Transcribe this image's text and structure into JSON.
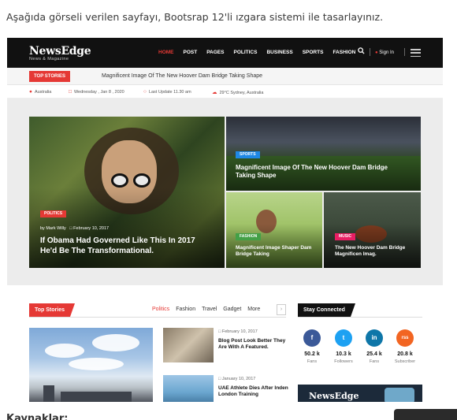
{
  "instruction": "Aşağıda görseli verilen sayfayı, Bootsrap 12'li ızgara sistemi ile tasarlayınız.",
  "site": {
    "logo": "NewsEdge",
    "logo_sub": "News & Magazine",
    "nav": [
      "HOME",
      "POST",
      "PAGES",
      "POLITICS",
      "BUSINESS",
      "SPORTS",
      "FASHION"
    ],
    "sign_in": "Sign In"
  },
  "ticker": {
    "badge": "TOP STORIES",
    "headline": "Magnificent Image Of The New Hoover Dam Bridge Taking Shape"
  },
  "infobar": {
    "location": "Australia",
    "date": "Wednesday , Jan 8 , 2020",
    "last_update": "Last Update 11.30 am",
    "weather": "29°C Sydney, Australia"
  },
  "hero": {
    "main": {
      "category": "POLITICS",
      "author_prefix": "by",
      "author": "Mark Willy",
      "date": "February 10, 2017",
      "title": "If Obama Had Governed Like This In 2017 He'd Be The Transformational."
    },
    "top": {
      "category": "SPORTS",
      "title": "Magnificent Image Of The New Hoover Dam Bridge Taking Shape"
    },
    "bottom_left": {
      "category": "FASHION",
      "title": "Magnificent Image Shaper Dam Bridge Taking"
    },
    "bottom_right": {
      "category": "MUSIC",
      "title": "The New Hoover Dam Bridge Magnificen Imag."
    }
  },
  "top_stories": {
    "badge": "Top Stories",
    "tabs": [
      "Politics",
      "Fashion",
      "Travel",
      "Gadget",
      "More"
    ],
    "posts": [
      {
        "date": "February 10, 2017",
        "title": "Blog Post Look Better They Are With A Featured."
      },
      {
        "date": "January 10, 2017",
        "title": "UAE Athlete Dies After Inden London Training"
      }
    ]
  },
  "stay_connected": {
    "badge": "Stay Connected",
    "items": [
      {
        "icon": "f",
        "count": "50.2 k",
        "label": "Fans",
        "color": "#3b5998"
      },
      {
        "icon": "t",
        "count": "10.3 k",
        "label": "Followers",
        "color": "#1da1f2"
      },
      {
        "icon": "in",
        "count": "25.4 k",
        "label": "Fans",
        "color": "#0e76a8"
      },
      {
        "icon": "rss",
        "count": "20.8 k",
        "label": "Subscriber",
        "color": "#f26522"
      }
    ],
    "promo_logo": "NewsEdge"
  },
  "footer_text": "Kaynaklar:",
  "colors": {
    "accent": "#e53935",
    "nav_bg": "#111111"
  }
}
